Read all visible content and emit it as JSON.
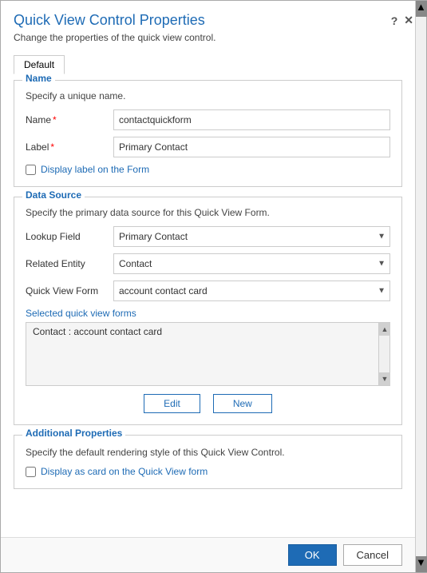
{
  "dialog": {
    "title": "Quick View Control Properties",
    "subtitle": "Change the properties of the quick view control.",
    "help_icon": "?",
    "close_icon": "✕"
  },
  "tabs": [
    {
      "label": "Default"
    }
  ],
  "name_section": {
    "legend": "Name",
    "desc": "Specify a unique name.",
    "name_label": "Name",
    "name_required": "*",
    "name_value": "contactquickform",
    "label_label": "Label",
    "label_required": "*",
    "label_value": "Primary Contact",
    "checkbox_label": "Display label on the Form"
  },
  "datasource_section": {
    "legend": "Data Source",
    "desc": "Specify the primary data source for this Quick View Form.",
    "lookup_label": "Lookup Field",
    "lookup_value": "Primary Contact",
    "lookup_options": [
      "Primary Contact"
    ],
    "related_label": "Related Entity",
    "related_value": "Contact",
    "related_options": [
      "Contact"
    ],
    "form_label": "Quick View Form",
    "form_value": "account contact card",
    "form_options": [
      "account contact card"
    ],
    "selected_label": "Selected quick view forms",
    "selected_item": "Contact : account contact card",
    "edit_button": "Edit",
    "new_button": "New"
  },
  "additional_section": {
    "legend": "Additional Properties",
    "desc": "Specify the default rendering style of this Quick View Control.",
    "checkbox_label": "Display as card on the Quick View form"
  },
  "footer": {
    "ok_label": "OK",
    "cancel_label": "Cancel"
  }
}
